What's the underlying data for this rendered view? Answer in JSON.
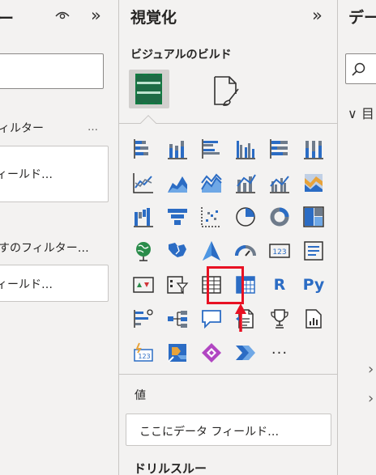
{
  "filter_pane": {
    "title": "ー",
    "eye_icon": "eye-icon",
    "collapse_icon": "double-chevron-right-icon",
    "collapse_glyph": "»",
    "section1_label": "ィルター",
    "section1_more": "…",
    "section1_well": "ィールド…",
    "section2_label": "すのフィルター…",
    "section2_well": "ィールド…"
  },
  "viz_pane": {
    "title": "視覚化",
    "collapse_glyph": "»",
    "subtitle": "ビジュアルのビルド",
    "tabs": [
      {
        "name": "build-visual",
        "icon": "build-visual-icon",
        "selected": true
      },
      {
        "name": "format-visual",
        "icon": "format-brush-icon",
        "selected": false
      }
    ],
    "visuals": [
      {
        "name": "stacked-bar-chart",
        "icon": "stacked-bar-icon"
      },
      {
        "name": "stacked-column-chart",
        "icon": "stacked-column-icon"
      },
      {
        "name": "clustered-bar-chart",
        "icon": "clustered-bar-icon"
      },
      {
        "name": "clustered-column-chart",
        "icon": "clustered-column-icon"
      },
      {
        "name": "100-stacked-bar-chart",
        "icon": "full-stacked-bar-icon"
      },
      {
        "name": "100-stacked-column-chart",
        "icon": "full-stacked-column-icon"
      },
      {
        "name": "line-chart",
        "icon": "line-chart-icon"
      },
      {
        "name": "area-chart",
        "icon": "area-chart-icon"
      },
      {
        "name": "stacked-area-chart",
        "icon": "stacked-area-icon"
      },
      {
        "name": "line-and-stacked-column-chart",
        "icon": "line-stacked-column-icon"
      },
      {
        "name": "line-and-clustered-column-chart",
        "icon": "line-clustered-column-icon"
      },
      {
        "name": "ribbon-chart",
        "icon": "ribbon-chart-icon"
      },
      {
        "name": "waterfall-chart",
        "icon": "waterfall-icon"
      },
      {
        "name": "funnel-chart",
        "icon": "funnel-icon"
      },
      {
        "name": "scatter-chart",
        "icon": "scatter-icon"
      },
      {
        "name": "pie-chart",
        "icon": "pie-icon"
      },
      {
        "name": "donut-chart",
        "icon": "donut-icon"
      },
      {
        "name": "treemap",
        "icon": "treemap-icon"
      },
      {
        "name": "map",
        "icon": "globe-icon"
      },
      {
        "name": "filled-map",
        "icon": "filled-map-icon"
      },
      {
        "name": "azure-map",
        "icon": "azure-map-icon"
      },
      {
        "name": "gauge",
        "icon": "gauge-icon"
      },
      {
        "name": "card",
        "icon": "card-icon",
        "text": "123"
      },
      {
        "name": "multi-row-card",
        "icon": "multi-row-card-icon"
      },
      {
        "name": "kpi",
        "icon": "kpi-icon"
      },
      {
        "name": "slicer",
        "icon": "slicer-icon"
      },
      {
        "name": "table",
        "icon": "table-icon",
        "highlighted": true
      },
      {
        "name": "matrix",
        "icon": "matrix-icon"
      },
      {
        "name": "r-script-visual",
        "icon": "r-icon",
        "text": "R"
      },
      {
        "name": "python-visual",
        "icon": "python-icon",
        "text": "Py"
      },
      {
        "name": "key-influencers",
        "icon": "key-influencers-icon"
      },
      {
        "name": "decomposition-tree",
        "icon": "decomposition-tree-icon"
      },
      {
        "name": "q-and-a",
        "icon": "qna-icon"
      },
      {
        "name": "smart-narrative",
        "icon": "smart-narrative-icon"
      },
      {
        "name": "metrics",
        "icon": "trophy-icon"
      },
      {
        "name": "paginated-report",
        "icon": "paginated-report-icon"
      },
      {
        "name": "power-apps",
        "icon": "power-apps-icon",
        "text": "123"
      },
      {
        "name": "power-automate-flow",
        "icon": "power-automate-icon"
      },
      {
        "name": "power-apps-visual",
        "icon": "power-apps-diamond-icon"
      },
      {
        "name": "power-automate",
        "icon": "power-automate-chevron-icon"
      },
      {
        "name": "more-visuals",
        "icon": "more-icon",
        "text": "···"
      }
    ],
    "values_label": "値",
    "values_well": "ここにデータ フィールド…",
    "drillthrough_label": "ドリルスルー"
  },
  "data_pane": {
    "title": "デー",
    "search_icon": "search-icon",
    "tree_item_glyph": "∨",
    "tree_item_text": "目",
    "expand_glyph": "›"
  },
  "colors": {
    "accent_blue": "#2b6cc4",
    "accent_green": "#107c41",
    "highlight_red": "#e81123",
    "pane_bg": "#f3f2f1"
  }
}
